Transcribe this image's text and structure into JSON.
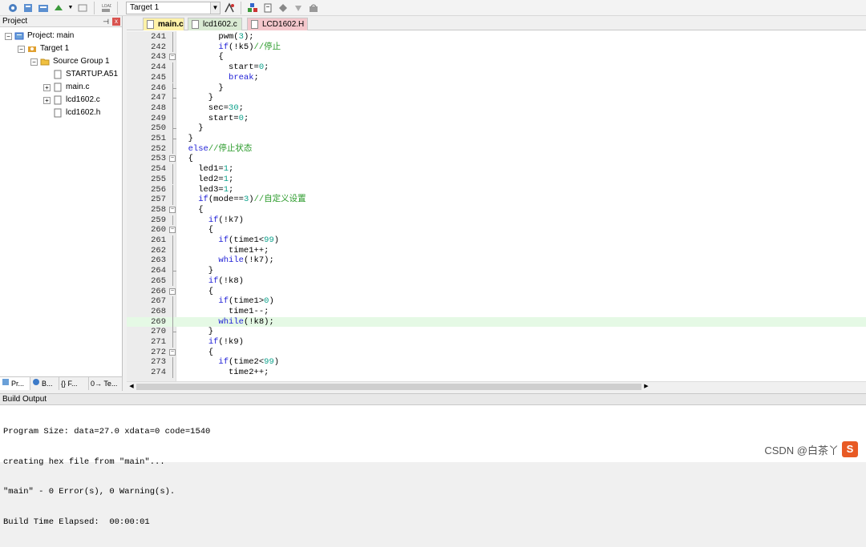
{
  "toolbar": {
    "target_value": "Target 1"
  },
  "project_panel": {
    "title": "Project",
    "pin_icon": "⊣",
    "close_icon": "x",
    "tree": [
      {
        "label": "Project: main",
        "expander": "−",
        "icon": "project-icon"
      },
      {
        "label": "Target 1",
        "expander": "−",
        "icon": "target-icon"
      },
      {
        "label": "Source Group 1",
        "expander": "−",
        "icon": "folder-icon"
      },
      {
        "label": "STARTUP.A51",
        "expander": "",
        "icon": "file-icon"
      },
      {
        "label": "main.c",
        "expander": "+",
        "icon": "file-icon"
      },
      {
        "label": "lcd1602.c",
        "expander": "+",
        "icon": "file-icon"
      },
      {
        "label": "lcd1602.h",
        "expander": "",
        "icon": "file-icon"
      }
    ],
    "bottom_tabs": [
      {
        "label": "Pr...",
        "icon": "project-tab-icon"
      },
      {
        "label": "B...",
        "icon": "books-tab-icon"
      },
      {
        "label": "{} F...",
        "icon": "functions-tab-icon"
      },
      {
        "label": "0→ Te...",
        "icon": "templates-tab-icon"
      }
    ]
  },
  "editor": {
    "tabs": [
      {
        "label": "main.c",
        "active": true,
        "color": "#fff2a8"
      },
      {
        "label": "lcd1602.c",
        "active": false,
        "color": "#d9ead3"
      },
      {
        "label": "LCD1602.H",
        "active": false,
        "color": "#f4c7cc"
      }
    ],
    "lines": [
      {
        "n": "241",
        "fold": "line",
        "code": "        pwm(3);"
      },
      {
        "n": "242",
        "fold": "line",
        "code": "        if(!k5)//停止"
      },
      {
        "n": "243",
        "fold": "box",
        "code": "        {"
      },
      {
        "n": "244",
        "fold": "line",
        "code": "          start=0;"
      },
      {
        "n": "245",
        "fold": "line",
        "code": "          break;"
      },
      {
        "n": "246",
        "fold": "end",
        "code": "        }"
      },
      {
        "n": "247",
        "fold": "end",
        "code": "      }"
      },
      {
        "n": "248",
        "fold": "line",
        "code": "      sec=30;"
      },
      {
        "n": "249",
        "fold": "line",
        "code": "      start=0;"
      },
      {
        "n": "250",
        "fold": "end",
        "code": "    }"
      },
      {
        "n": "251",
        "fold": "end",
        "code": "  }"
      },
      {
        "n": "252",
        "fold": "line",
        "code": "  else//停止状态"
      },
      {
        "n": "253",
        "fold": "box",
        "code": "  {"
      },
      {
        "n": "254",
        "fold": "line",
        "code": "    led1=1;"
      },
      {
        "n": "255",
        "fold": "line",
        "code": "    led2=1;"
      },
      {
        "n": "256",
        "fold": "line",
        "code": "    led3=1;"
      },
      {
        "n": "257",
        "fold": "line",
        "code": "    if(mode==3)//自定义设置"
      },
      {
        "n": "258",
        "fold": "box",
        "code": "    {"
      },
      {
        "n": "259",
        "fold": "line",
        "code": "      if(!k7)"
      },
      {
        "n": "260",
        "fold": "box",
        "code": "      {"
      },
      {
        "n": "261",
        "fold": "line",
        "code": "        if(time1<99)"
      },
      {
        "n": "262",
        "fold": "line",
        "code": "          time1++;"
      },
      {
        "n": "263",
        "fold": "line",
        "code": "        while(!k7);"
      },
      {
        "n": "264",
        "fold": "end",
        "code": "      }"
      },
      {
        "n": "265",
        "fold": "line",
        "code": "      if(!k8)"
      },
      {
        "n": "266",
        "fold": "box",
        "code": "      {"
      },
      {
        "n": "267",
        "fold": "line",
        "code": "        if(time1>0)"
      },
      {
        "n": "268",
        "fold": "line",
        "code": "          time1--;"
      },
      {
        "n": "269",
        "fold": "line",
        "code": "        while(!k8);",
        "highlight": true
      },
      {
        "n": "270",
        "fold": "end",
        "code": "      }"
      },
      {
        "n": "271",
        "fold": "line",
        "code": "      if(!k9)"
      },
      {
        "n": "272",
        "fold": "box",
        "code": "      {"
      },
      {
        "n": "273",
        "fold": "line",
        "code": "        if(time2<99)"
      },
      {
        "n": "274",
        "fold": "line",
        "code": "          time2++;"
      }
    ]
  },
  "build_output": {
    "title": "Build Output",
    "lines": [
      "Program Size: data=27.0 xdata=0 code=1540",
      "creating hex file from \"main\"...",
      "\"main\" - 0 Error(s), 0 Warning(s).",
      "Build Time Elapsed:  00:00:01"
    ]
  },
  "watermark": {
    "logo": "S",
    "text": "CSDN @白茶丫"
  },
  "colors": {
    "keyword": "#1f1fd6",
    "number": "#0da18b",
    "comment": "#2a9a2a",
    "current_line": "#e5f9e5"
  }
}
